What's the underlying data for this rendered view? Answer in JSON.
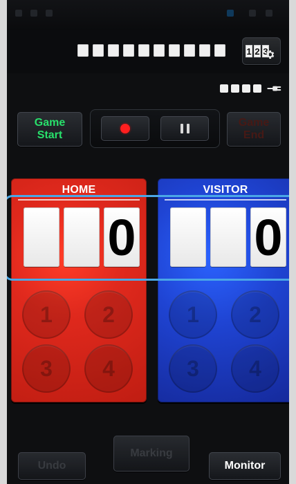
{
  "status_bar": {},
  "top": {
    "settings_icon_text": [
      "1",
      "2",
      "3"
    ],
    "settings_icon_name": "scoreboard-settings-icon"
  },
  "battery": {
    "icon_name": "battery-plug-icon"
  },
  "controls": {
    "game_start_label": "Game\nStart",
    "game_end_label": "Game\nEnd",
    "record_icon_name": "record-icon",
    "pause_icon_name": "pause-icon"
  },
  "teams": {
    "home": {
      "label": "HOME",
      "digits": [
        "",
        "",
        "0"
      ],
      "buttons": [
        "1",
        "2",
        "3",
        "4"
      ],
      "color": "#e0291d"
    },
    "visitor": {
      "label": "VISITOR",
      "digits": [
        "",
        "",
        "0"
      ],
      "buttons": [
        "1",
        "2",
        "3",
        "4"
      ],
      "color": "#1f44d3"
    }
  },
  "bottom": {
    "undo_label": "Undo",
    "marking_label": "Marking",
    "monitor_label": "Monitor"
  }
}
